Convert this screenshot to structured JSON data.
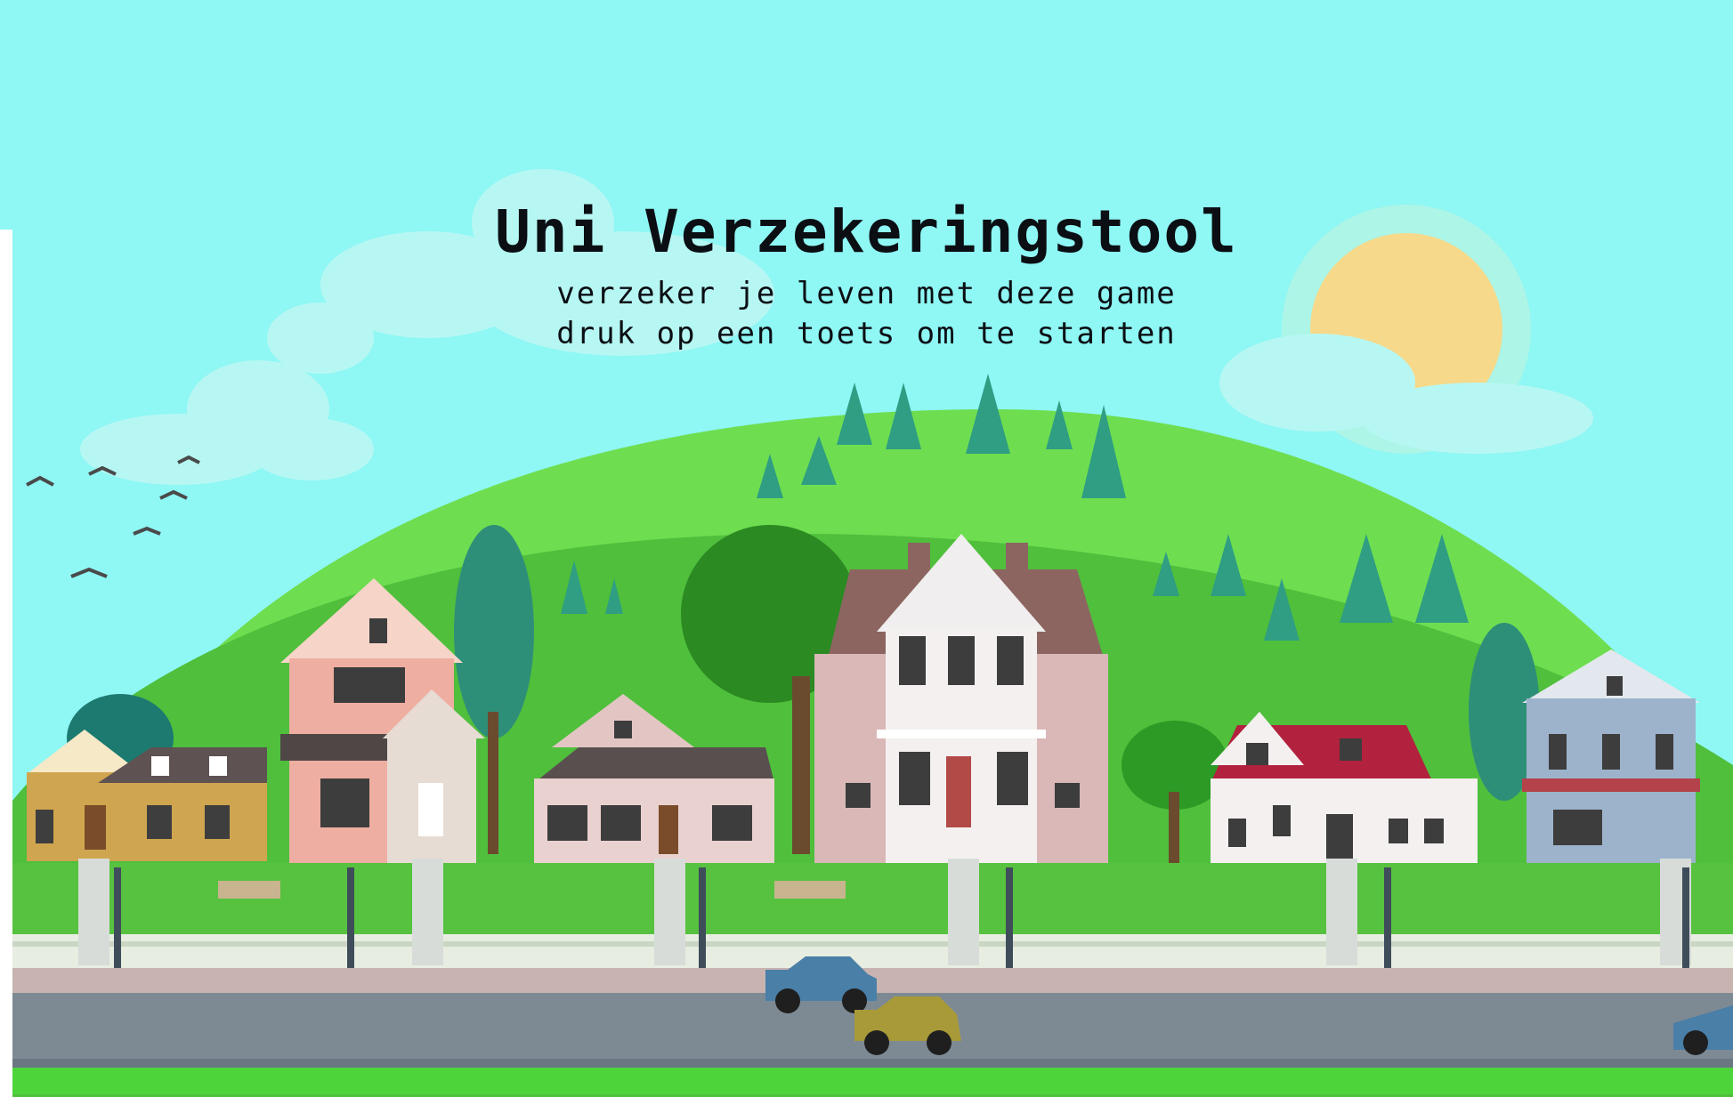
{
  "game": {
    "title": "Uni Verzekeringstool",
    "subtitle": "verzeker je leven met deze game",
    "prompt": "druk op een toets om te starten"
  },
  "colors": {
    "sky": "#8ff7f4",
    "hill_back": "#6ede50",
    "hill_front": "#4fbf3c",
    "grass": "#56c23f",
    "road": "#7d8a94",
    "sidewalk": "#c8b3b1",
    "sun": "#f6d98a"
  }
}
